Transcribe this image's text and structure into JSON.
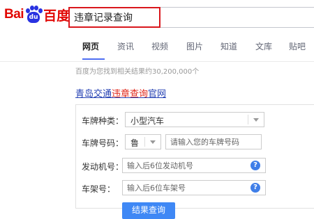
{
  "logo": {
    "left": "Bai",
    "paw_text": "du",
    "right": "百度"
  },
  "search": {
    "query": "违章记录查询"
  },
  "tabs": [
    {
      "label": "网页",
      "active": true
    },
    {
      "label": "资讯"
    },
    {
      "label": "视频"
    },
    {
      "label": "图片"
    },
    {
      "label": "知道"
    },
    {
      "label": "文库"
    },
    {
      "label": "贴吧"
    }
  ],
  "result_count": "百度为您找到相关结果约30,200,000个",
  "result": {
    "title_pre": "青岛交通",
    "title_em": "违章查询",
    "title_post": "官网"
  },
  "form": {
    "plate_type_label": "车牌种类：",
    "plate_type_value": "小型汽车",
    "plate_no_label": "车牌号码：",
    "plate_prefix": "鲁",
    "plate_no_placeholder": "请输入您的车牌号码",
    "engine_label": "发动机号：",
    "engine_placeholder": "输入后6位发动机号",
    "frame_label": "车架号：",
    "frame_placeholder": "输入后6位车架号",
    "help_icon": "?",
    "submit_label": "结果查询"
  },
  "colors": {
    "accent": "#4e6ef2",
    "link": "#2440b3",
    "highlight": "#e0271a",
    "search_border": "#d9161c",
    "button": "#3f88f5"
  }
}
